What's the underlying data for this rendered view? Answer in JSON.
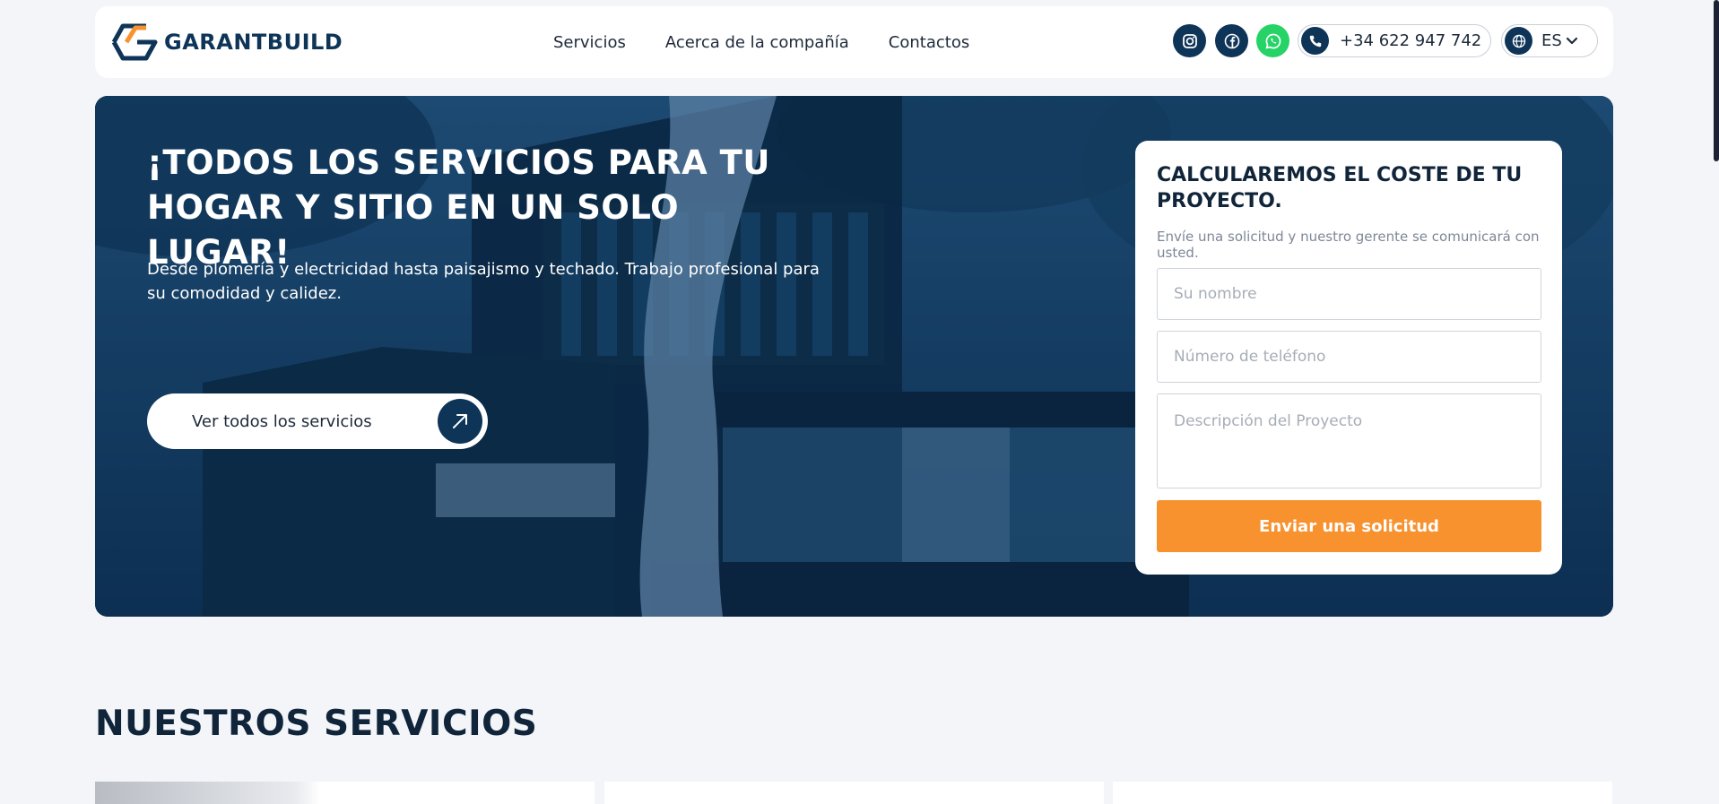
{
  "brand": {
    "name": "GARANTBUILD",
    "accent": "#f7922f",
    "primary": "#0e3558"
  },
  "nav": {
    "items": [
      "Servicios",
      "Acerca de la compañía",
      "Contactos"
    ]
  },
  "header": {
    "social": [
      "instagram-icon",
      "facebook-icon",
      "whatsapp-icon"
    ],
    "phone": "+34 622 947 742",
    "language": "ES"
  },
  "hero": {
    "title": "¡TODOS LOS SERVICIOS PARA TU HOGAR Y SITIO EN UN SOLO LUGAR!",
    "subtitle": "Desde plomería y electricidad hasta paisajismo y techado. Trabajo profesional para su comodidad y calidez.",
    "cta_label": "Ver todos los servicios"
  },
  "form": {
    "title": "CALCULAREMOS EL COSTE DE TU PROYECTO.",
    "description": "Envíe una solicitud y nuestro gerente se comunicará con usted.",
    "name_placeholder": "Su nombre",
    "phone_placeholder": "Número de teléfono",
    "description_placeholder": "Descripción del Proyecto",
    "submit_label": "Enviar una solicitud"
  },
  "services": {
    "title": "NUESTROS SERVICIOS"
  }
}
